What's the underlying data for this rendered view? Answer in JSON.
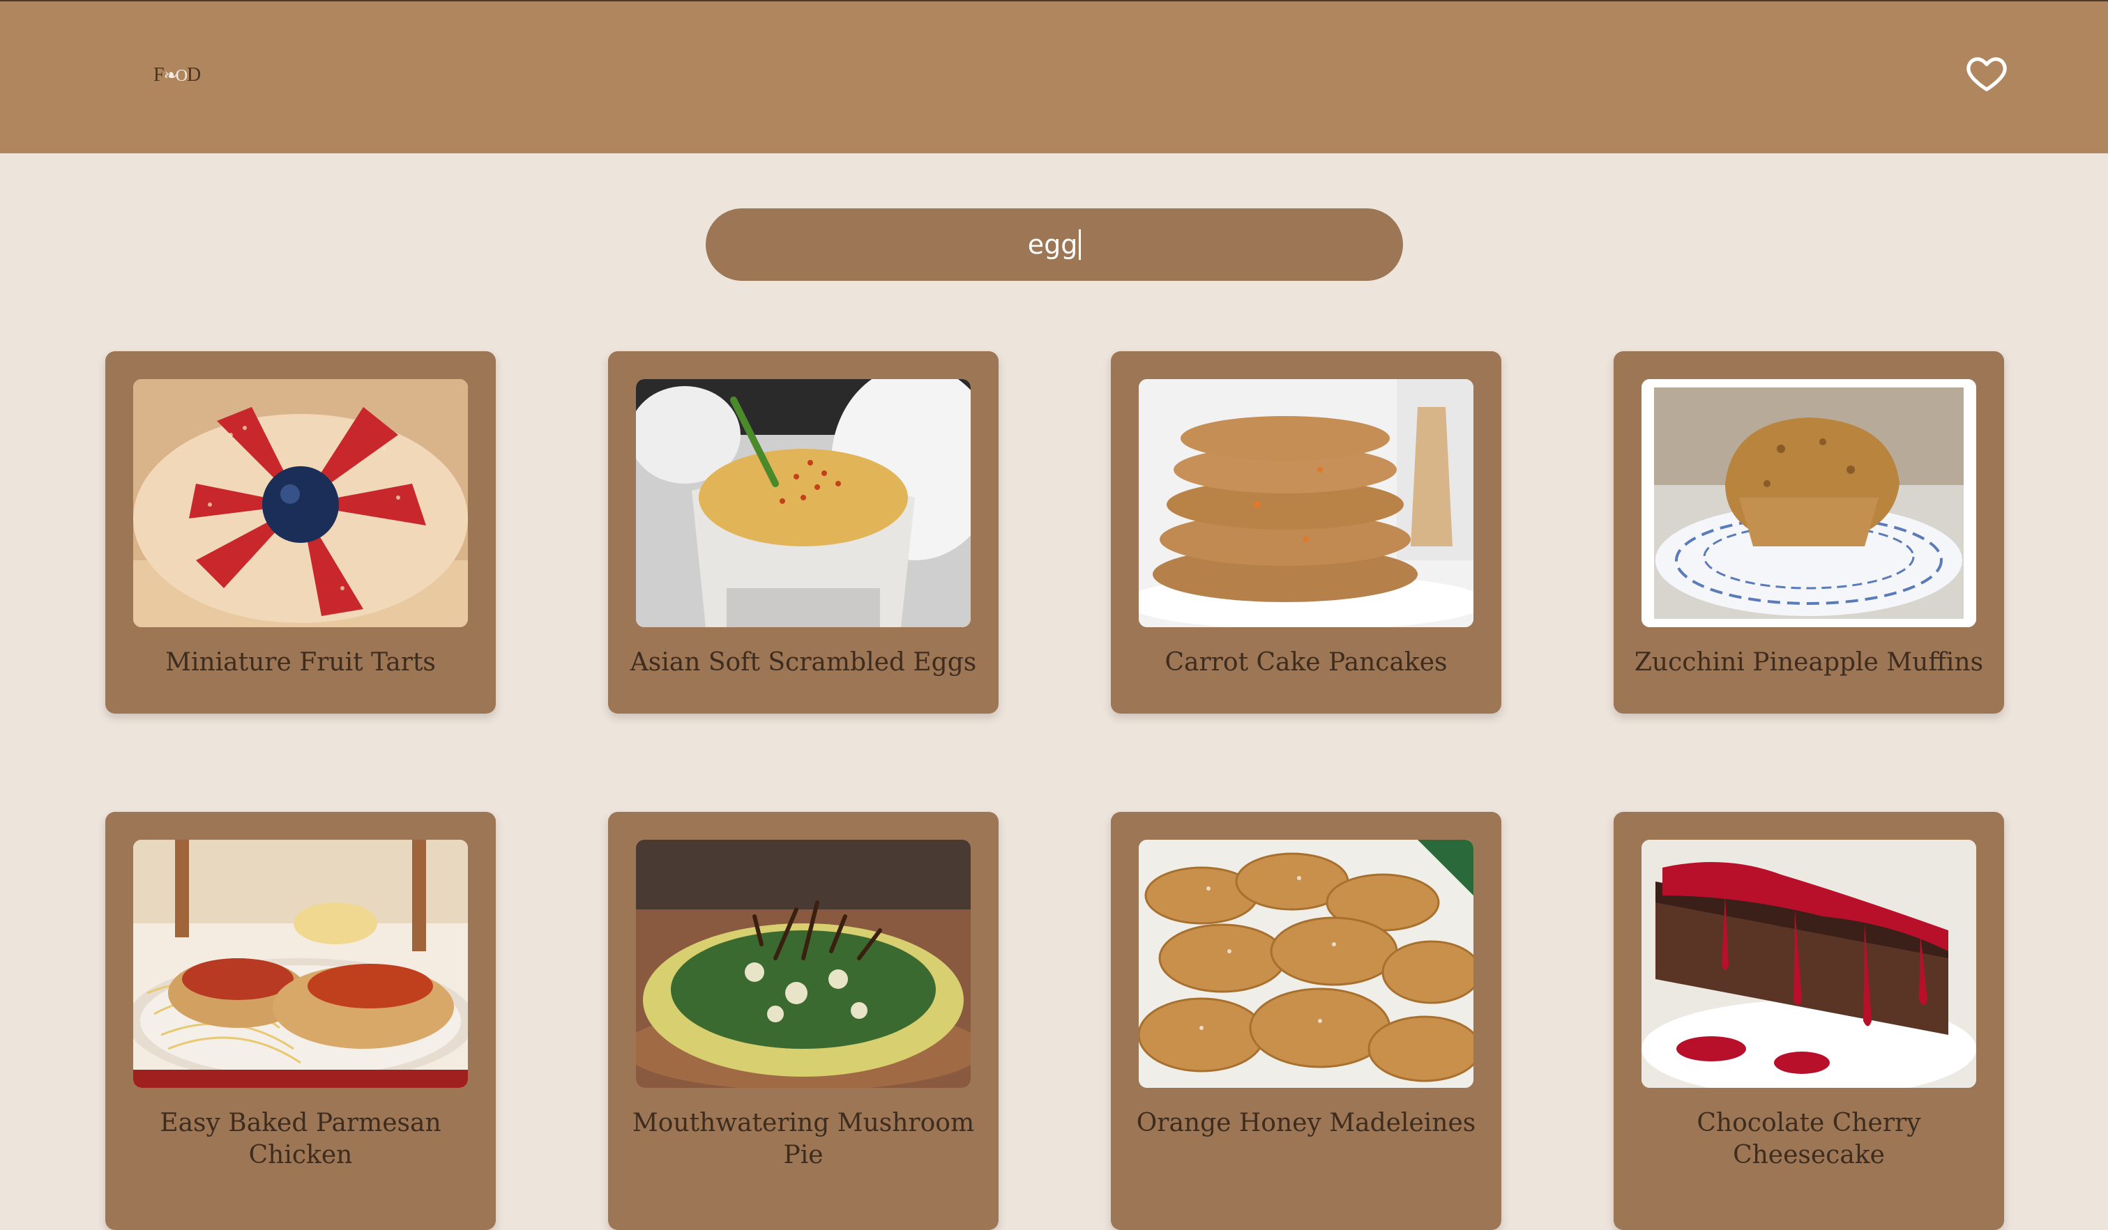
{
  "header": {
    "logo_text_left": "F",
    "logo_text_right": "D",
    "favorites_icon": "heart-outline-icon"
  },
  "search": {
    "value": "egg",
    "placeholder": ""
  },
  "recipes": [
    {
      "title": "Miniature Fruit Tarts",
      "image": "fruit-tart-photo"
    },
    {
      "title": "Asian Soft Scrambled Eggs",
      "image": "scrambled-eggs-photo"
    },
    {
      "title": "Carrot Cake Pancakes",
      "image": "pancakes-photo"
    },
    {
      "title": "Zucchini Pineapple Muffins",
      "image": "muffin-photo"
    },
    {
      "title": "Easy Baked Parmesan Chicken",
      "image": "parmesan-chicken-photo"
    },
    {
      "title": "Mouthwatering Mushroom Pie",
      "image": "mushroom-pie-photo"
    },
    {
      "title": "Orange Honey Madeleines",
      "image": "madeleines-photo"
    },
    {
      "title": "Chocolate Cherry Cheesecake",
      "image": "cheesecake-photo"
    }
  ],
  "colors": {
    "header_bg": "#b0865e",
    "page_bg": "#ede4dc",
    "card_bg": "#9c7655",
    "title_text": "#3e2c1e",
    "search_bg": "#9c7655"
  }
}
